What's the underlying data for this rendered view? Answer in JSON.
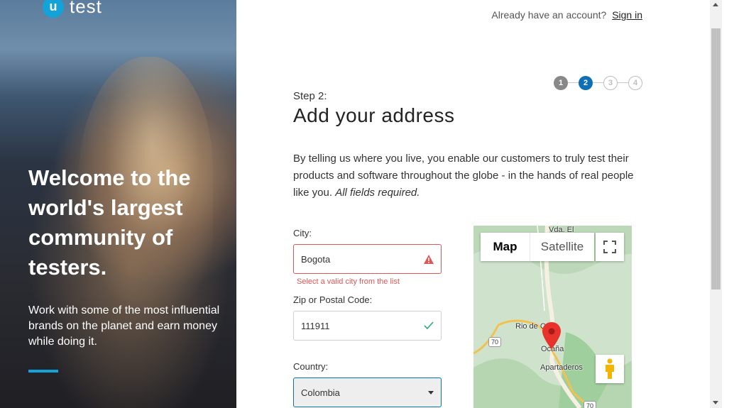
{
  "hero": {
    "logo_mark": "u",
    "logo_text": "test",
    "title": "Welcome to the world's largest community of testers.",
    "subtitle": "Work with some of the most influential brands on the planet and earn money while doing it."
  },
  "header": {
    "account_prompt": "Already have an account?",
    "signin_label": "Sign in"
  },
  "stepper": {
    "current": 2,
    "steps": [
      "1",
      "2",
      "3",
      "4"
    ]
  },
  "form": {
    "step_label": "Step 2:",
    "title": "Add your address",
    "intro": "By telling us where you live, you enable our customers to truly test their products and software throughout the globe - in the hands of real people like you.",
    "intro_emphasis": "All fields required.",
    "city": {
      "label": "City:",
      "value": "Bogota",
      "error": "Select a valid city from the list"
    },
    "zip": {
      "label": "Zip or Postal Code:",
      "value": "111911"
    },
    "country": {
      "label": "Country:",
      "value": "Colombia"
    }
  },
  "map": {
    "map_label": "Map",
    "satellite_label": "Satellite",
    "places": [
      "Vda. El",
      "Rio de C",
      "Ocaña",
      "Apartaderos"
    ],
    "route_shields": [
      "70",
      "70"
    ]
  },
  "colors": {
    "accent": "#14a3d9",
    "step_active": "#0f6fb5",
    "error": "#e05656",
    "success": "#2aa876"
  }
}
